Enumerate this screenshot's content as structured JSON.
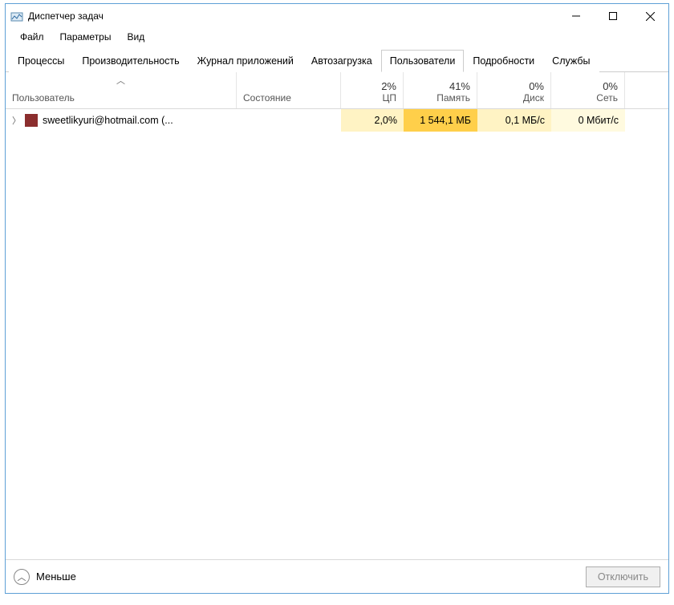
{
  "window": {
    "title": "Диспетчер задач"
  },
  "menu": {
    "file": "Файл",
    "options": "Параметры",
    "view": "Вид"
  },
  "tabs": {
    "processes": "Процессы",
    "performance": "Производительность",
    "app_history": "Журнал приложений",
    "startup": "Автозагрузка",
    "users": "Пользователи",
    "details": "Подробности",
    "services": "Службы",
    "active": "users"
  },
  "columns": {
    "user": "Пользователь",
    "state": "Состояние",
    "cpu_pct": "2%",
    "cpu_label": "ЦП",
    "mem_pct": "41%",
    "mem_label": "Память",
    "disk_pct": "0%",
    "disk_label": "Диск",
    "net_pct": "0%",
    "net_label": "Сеть"
  },
  "rows": [
    {
      "user": "sweetlikyuri@hotmail.com (...",
      "state": "",
      "cpu": "2,0%",
      "mem": "1 544,1 МБ",
      "disk": "0,1 МБ/с",
      "net": "0 Мбит/с"
    }
  ],
  "footer": {
    "fewer": "Меньше",
    "disconnect": "Отключить"
  },
  "colors": {
    "heat_low": "#fffadf",
    "heat_mid": "#fff3c4",
    "heat_high": "#ffcf4a",
    "border": "#5da0d6"
  }
}
